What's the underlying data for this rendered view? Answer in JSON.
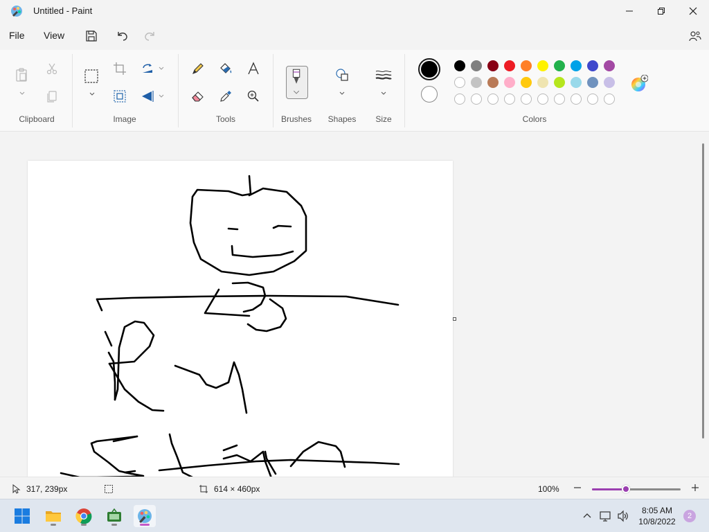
{
  "window": {
    "title": "Untitled - Paint"
  },
  "menu": {
    "file": "File",
    "view": "View"
  },
  "ribbon": {
    "groups": {
      "clipboard": "Clipboard",
      "image": "Image",
      "tools": "Tools",
      "brushes": "Brushes",
      "shapes": "Shapes",
      "size": "Size",
      "colors": "Colors"
    }
  },
  "colors": {
    "primary": "#000000",
    "secondary": "#ffffff",
    "palette_row1": [
      "#000000",
      "#7f7f7f",
      "#880015",
      "#ed1c24",
      "#ff7f27",
      "#fff200",
      "#22b14c",
      "#00a2e8",
      "#3f48cc",
      "#a349a4"
    ],
    "palette_row2": [
      "#ffffff",
      "#c3c3c3",
      "#b97a57",
      "#ffaec9",
      "#ffc90e",
      "#efe4b0",
      "#b5e61d",
      "#99d9ea",
      "#7092be",
      "#c8bfe7"
    ],
    "accent": "#9b3fb0"
  },
  "status": {
    "cursor_position": "317, 239px",
    "canvas_size": "614 × 460px",
    "zoom": "100%",
    "zoom_fraction": 0.38
  },
  "taskbar": {
    "time": "8:05 AM",
    "date": "10/8/2022",
    "notification_count": "2"
  }
}
